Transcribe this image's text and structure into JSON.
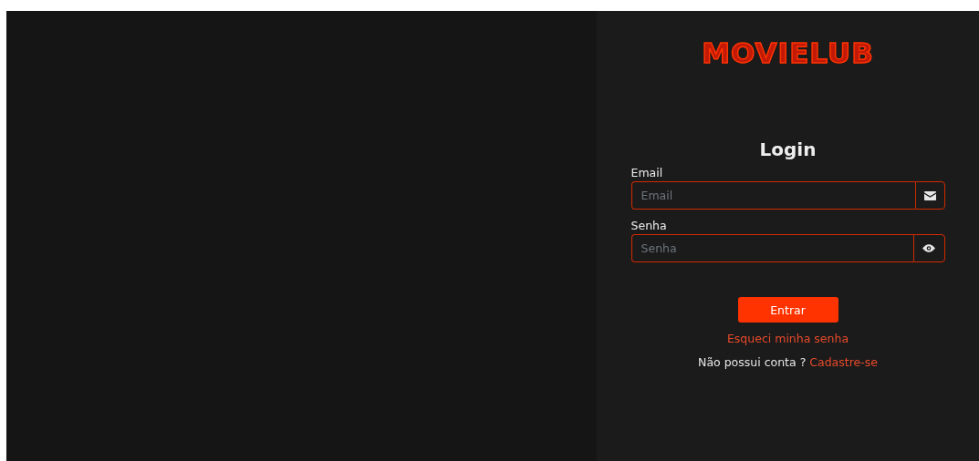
{
  "logo": {
    "text": "MOVIELUB"
  },
  "form": {
    "title": "Login",
    "fields": [
      {
        "label": "Email",
        "placeholder": "Email",
        "kind": "email"
      },
      {
        "label": "Senha",
        "placeholder": "Senha",
        "kind": "password"
      }
    ],
    "submit": "Entrar",
    "forgot_link": "Esqueci minha senha",
    "signup_prompt": "Não possui conta ?",
    "signup_link": "Cadastre-se"
  }
}
